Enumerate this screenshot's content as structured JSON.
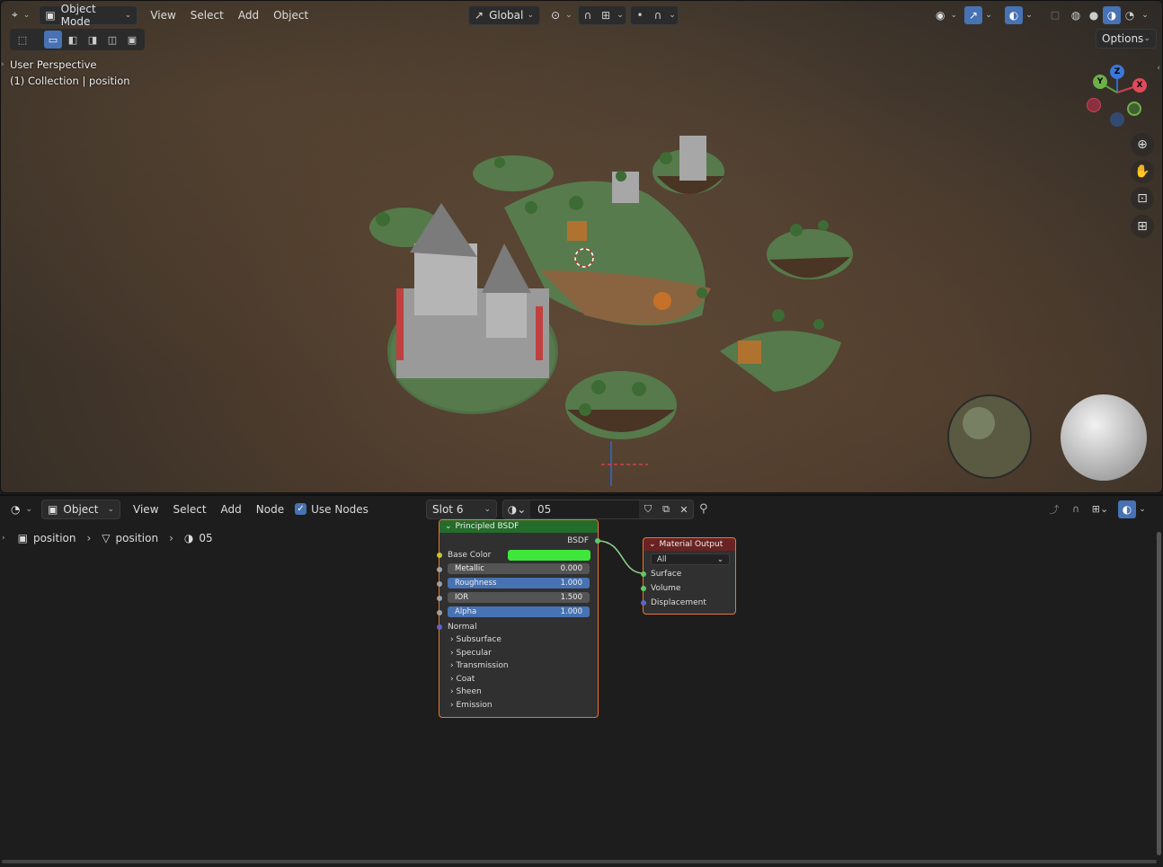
{
  "viewport": {
    "header": {
      "mode_label": "Object Mode",
      "menus": [
        "View",
        "Select",
        "Add",
        "Object"
      ],
      "orientation_label": "Global",
      "options_label": "Options"
    },
    "overlay": {
      "perspective": "User Perspective",
      "collection": "(1) Collection | position"
    },
    "gizmo": {
      "z": "Z",
      "y": "Y",
      "x": "X"
    }
  },
  "node_editor": {
    "header": {
      "editor_type_label": "Object",
      "menus": [
        "View",
        "Select",
        "Add",
        "Node"
      ],
      "use_nodes_label": "Use Nodes",
      "use_nodes_checked": true,
      "slot_label": "Slot 6",
      "material_name": "05"
    },
    "breadcrumb": {
      "object": "position",
      "mesh": "position",
      "material": "05"
    },
    "bsdf_node": {
      "title": "Principled BSDF",
      "output": "BSDF",
      "base_color_label": "Base Color",
      "base_color": "#3fe63c",
      "metallic_label": "Metallic",
      "metallic_value": "0.000",
      "metallic_fill": 0.0,
      "roughness_label": "Roughness",
      "roughness_value": "1.000",
      "roughness_fill": 1.0,
      "ior_label": "IOR",
      "ior_value": "1.500",
      "alpha_label": "Alpha",
      "alpha_value": "1.000",
      "alpha_fill": 1.0,
      "normal_label": "Normal",
      "panels": [
        "Subsurface",
        "Specular",
        "Transmission",
        "Coat",
        "Sheen",
        "Emission"
      ]
    },
    "output_node": {
      "title": "Material Output",
      "target": "All",
      "inputs": [
        "Surface",
        "Volume",
        "Displacement"
      ]
    }
  },
  "colors": {
    "accent": "#4772b3",
    "bsdf_header": "#246c2b",
    "output_header": "#6b2222",
    "selected_outline": "#e8772e"
  }
}
